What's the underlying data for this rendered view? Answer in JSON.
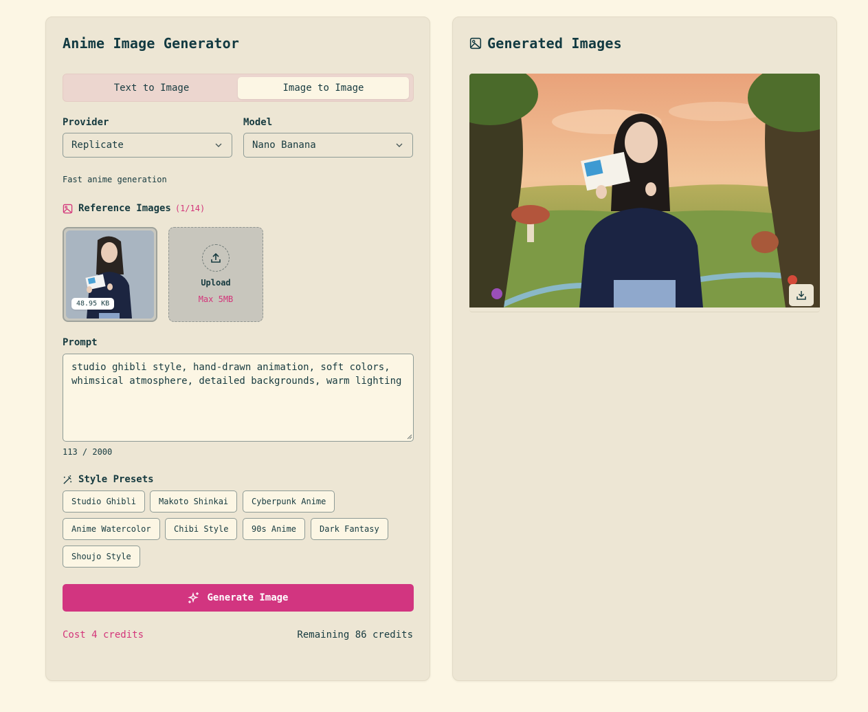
{
  "left_panel": {
    "title": "Anime Image Generator",
    "tabs": [
      {
        "label": "Text to Image",
        "active": false
      },
      {
        "label": "Image to Image",
        "active": true
      }
    ],
    "provider": {
      "label": "Provider",
      "value": "Replicate"
    },
    "model": {
      "label": "Model",
      "value": "Nano Banana"
    },
    "model_hint": "Fast anime generation",
    "reference": {
      "label": "Reference Images",
      "count": "(1/14)",
      "thumb_size": "48.95 KB",
      "upload_label": "Upload",
      "upload_limit": "Max 5MB"
    },
    "prompt": {
      "label": "Prompt",
      "value": "studio ghibli style, hand-drawn animation, soft colors, whimsical atmosphere, detailed backgrounds, warm lighting",
      "counter": "113 / 2000"
    },
    "presets": {
      "label": "Style Presets",
      "items": [
        "Studio Ghibli",
        "Makoto Shinkai",
        "Cyberpunk Anime",
        "Anime Watercolor",
        "Chibi Style",
        "90s Anime",
        "Dark Fantasy",
        "Shoujo Style"
      ]
    },
    "generate_label": "Generate Image",
    "cost": "Cost 4 credits",
    "remaining": "Remaining 86 credits"
  },
  "right_panel": {
    "title": "Generated Images"
  },
  "icons": {
    "reference": "image-icon",
    "presets": "wand-icon",
    "generate": "sparkles-icon",
    "upload": "upload-icon",
    "download": "download-icon",
    "gallery": "image-icon"
  },
  "colors": {
    "accent": "#d23580",
    "background": "#fcf6e4",
    "panel": "#ede6d4",
    "text": "#163a3f"
  }
}
